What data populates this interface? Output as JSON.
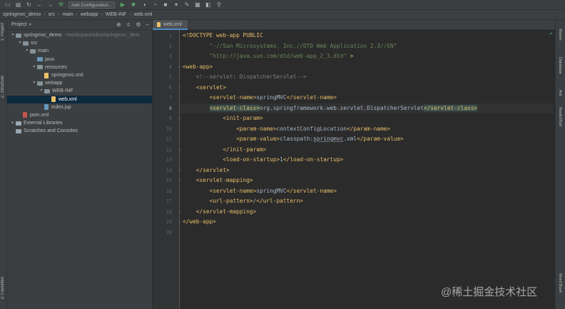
{
  "toolbar": {
    "project_name": "springmvc_demo",
    "run_config_label": "Add Configuration..."
  },
  "breadcrumbs": [
    "springmvc_demo",
    "src",
    "main",
    "webapp",
    "WEB-INF",
    "web.xml"
  ],
  "project_panel": {
    "title": "Project",
    "tree": [
      {
        "label": "springmvc_demo",
        "path": "~/workspace/idea/springmvc_dem",
        "depth": 0,
        "kind": "module",
        "expanded": true
      },
      {
        "label": "src",
        "depth": 1,
        "kind": "folder",
        "expanded": true
      },
      {
        "label": "main",
        "depth": 2,
        "kind": "folder",
        "expanded": true
      },
      {
        "label": "java",
        "depth": 3,
        "kind": "source-folder"
      },
      {
        "label": "resources",
        "depth": 3,
        "kind": "folder",
        "expanded": true
      },
      {
        "label": "springmvc.xml",
        "depth": 4,
        "kind": "xml-file"
      },
      {
        "label": "webapp",
        "depth": 3,
        "kind": "folder",
        "expanded": true
      },
      {
        "label": "WEB-INF",
        "depth": 4,
        "kind": "folder",
        "expanded": true
      },
      {
        "label": "web.xml",
        "depth": 5,
        "kind": "xml-file",
        "selected": true
      },
      {
        "label": "index.jsp",
        "depth": 4,
        "kind": "jsp-file"
      },
      {
        "label": "pom.xml",
        "depth": 1,
        "kind": "maven-file"
      },
      {
        "label": "External Libraries",
        "depth": 0,
        "kind": "library",
        "expanded": false
      },
      {
        "label": "Scratches and Consoles",
        "depth": 0,
        "kind": "scratch"
      }
    ]
  },
  "left_tool_tabs": [
    "1: Project",
    "Z: Structure",
    "2: Favorites"
  ],
  "right_tool_tabs": [
    "Maven",
    "Database",
    "Ant",
    "RestfulTool",
    "Word Book"
  ],
  "editor": {
    "active_tab": "web.xml",
    "current_line": 8,
    "lines": [
      [
        [
          "t-tag",
          "<!DOCTYPE web-app PUBLIC"
        ]
      ],
      [
        [
          "t-str",
          "        \"-//Sun Microsystems, Inc.//DTD Web Application 2.3//EN\""
        ]
      ],
      [
        [
          "t-str",
          "        \"http://java.sun.com/dtd/web-app_2_3.dtd\""
        ],
        [
          "t-tag",
          " >"
        ]
      ],
      [
        [
          "t-tag",
          "<web-app>"
        ]
      ],
      [
        [
          "t-com",
          "    <!--servlet: DispatcherServlet-->"
        ]
      ],
      [
        [
          "t-tag",
          "    <servlet>"
        ]
      ],
      [
        [
          "t-tag",
          "        <servlet-name>"
        ],
        [
          "t-txt",
          "springMVC"
        ],
        [
          "t-tag",
          "</servlet-name>"
        ]
      ],
      [
        [
          "t-tag",
          "        "
        ],
        [
          "t-tag t-hl",
          "<servlet-class>"
        ],
        [
          "t-txt",
          "org.springframework.web.servlet.DispatcherServlet"
        ],
        [
          "t-tag t-hl",
          "</servlet-class>"
        ]
      ],
      [
        [
          "t-tag",
          "            <init-param>"
        ]
      ],
      [
        [
          "t-tag",
          "                <param-name>"
        ],
        [
          "t-txt",
          "contextConfigLocation"
        ],
        [
          "t-tag",
          "</param-name>"
        ]
      ],
      [
        [
          "t-tag",
          "                <param-value>"
        ],
        [
          "t-txt",
          "classpath:"
        ],
        [
          "t-txt t-ul",
          "springmvc"
        ],
        [
          "t-txt",
          ".xml"
        ],
        [
          "t-tag",
          "</param-value>"
        ]
      ],
      [
        [
          "t-tag",
          "            </init-param>"
        ]
      ],
      [
        [
          "t-tag",
          "            <load-on-startup>"
        ],
        [
          "t-txt",
          "1"
        ],
        [
          "t-tag",
          "</load-on-startup>"
        ]
      ],
      [
        [
          "t-tag",
          "    </servlet>"
        ]
      ],
      [
        [
          "t-tag",
          "    <servlet-mapping>"
        ]
      ],
      [
        [
          "t-tag",
          "        <servlet-name>"
        ],
        [
          "t-txt",
          "springMVC"
        ],
        [
          "t-tag",
          "</servlet-name>"
        ]
      ],
      [
        [
          "t-tag",
          "        <url-pattern>"
        ],
        [
          "t-txt",
          "/"
        ],
        [
          "t-tag",
          "</url-pattern>"
        ]
      ],
      [
        [
          "t-tag",
          "    </servlet-mapping>"
        ]
      ],
      [
        [
          "t-tag",
          "</web-app>"
        ]
      ],
      []
    ]
  },
  "watermark": "@稀土掘金技术社区",
  "colors": {
    "background": "#2b2b2b",
    "panel": "#3c3f41",
    "tag": "#e8bf6a",
    "string": "#6a8759",
    "comment": "#808080",
    "text": "#a9b7c6",
    "selection": "#0d293e",
    "accent": "#4a88c7"
  }
}
